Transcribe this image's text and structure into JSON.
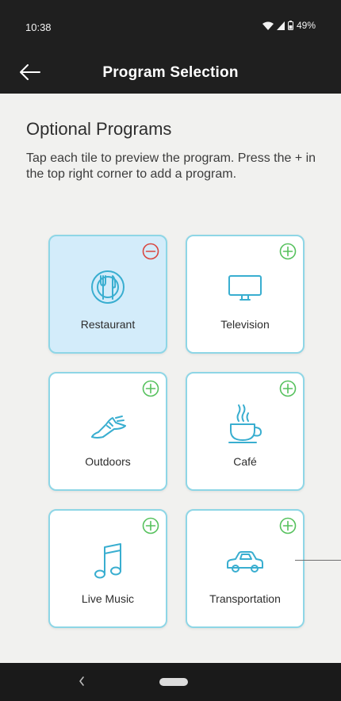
{
  "status_bar": {
    "time": "10:38",
    "battery": "49%"
  },
  "app_bar": {
    "title": "Program Selection"
  },
  "content": {
    "heading": "Optional Programs",
    "description": "Tap each tile to preview the program. Press the + in the top right corner to add a program."
  },
  "tiles": [
    {
      "label": "Restaurant",
      "icon": "restaurant-icon",
      "action": "remove"
    },
    {
      "label": "Television",
      "icon": "television-icon",
      "action": "add"
    },
    {
      "label": "Outdoors",
      "icon": "sneaker-icon",
      "action": "add"
    },
    {
      "label": "Café",
      "icon": "coffee-cup-icon",
      "action": "add"
    },
    {
      "label": "Live Music",
      "icon": "music-note-icon",
      "action": "add"
    },
    {
      "label": "Transportation",
      "icon": "car-icon",
      "action": "add"
    }
  ],
  "colors": {
    "tile_border": "#8ed6e6",
    "icon_stroke": "#39aed0",
    "add_green": "#56c15d",
    "remove_red": "#d9463f",
    "selected_tile": "#d3ecfa"
  }
}
